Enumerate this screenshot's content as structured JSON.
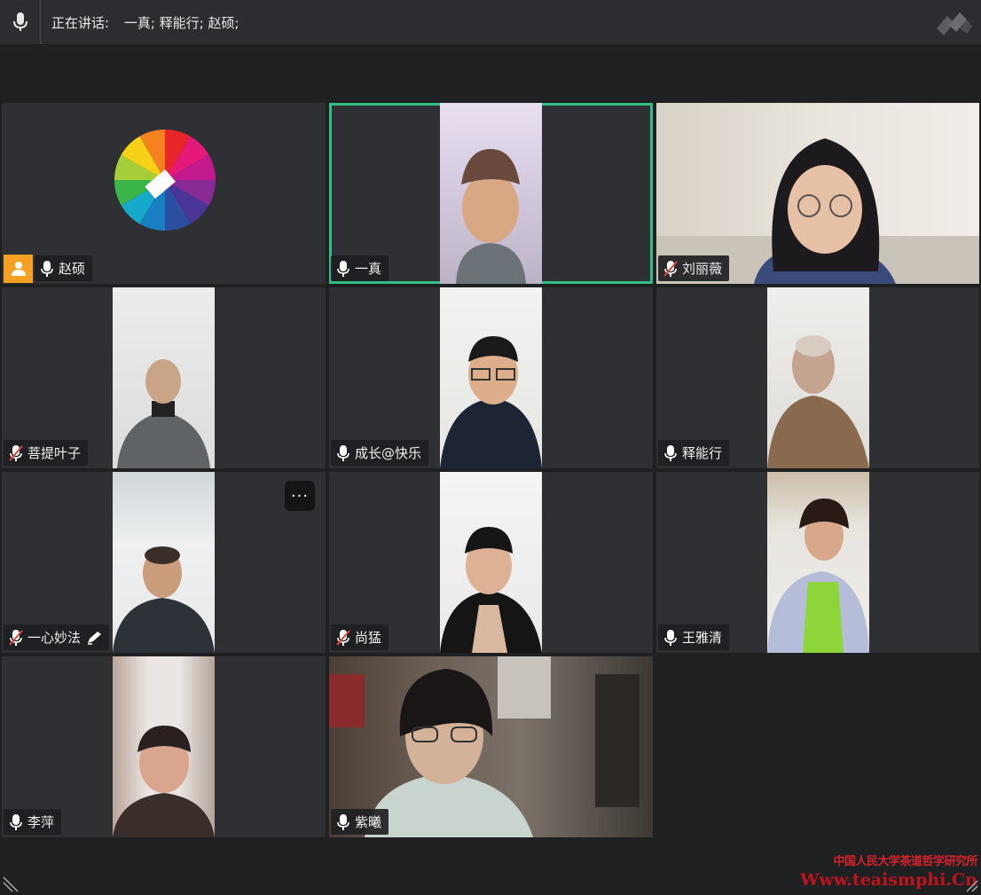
{
  "topbar": {
    "speaking_label": "正在讲话:",
    "speaking_names": "一真; 释能行; 赵硕;",
    "mic_icon": "microphone-icon",
    "logo_icon": "app-logo-icon"
  },
  "participants": [
    {
      "name": "赵硕",
      "mic": "on",
      "host": true,
      "video": "color-wheel-avatar"
    },
    {
      "name": "一真",
      "mic": "on",
      "active_speaker": true,
      "video": "camera"
    },
    {
      "name": "刘丽薇",
      "mic": "muted",
      "video": "camera-wide"
    },
    {
      "name": "菩提叶子",
      "mic": "muted",
      "video": "camera"
    },
    {
      "name": "成长@快乐",
      "mic": "on",
      "video": "camera"
    },
    {
      "name": "释能行",
      "mic": "on",
      "video": "camera"
    },
    {
      "name": "一心妙法",
      "mic": "muted",
      "annotate": true,
      "video": "camera"
    },
    {
      "name": "尚猛",
      "mic": "muted",
      "video": "camera"
    },
    {
      "name": "王雅清",
      "mic": "on",
      "video": "camera"
    },
    {
      "name": "李萍",
      "mic": "on",
      "video": "camera"
    },
    {
      "name": "紫曦",
      "mic": "on",
      "video": "camera-wide"
    }
  ],
  "more_button": "···",
  "watermark": {
    "line1": "中国人民大学茶道哲学研究所",
    "line2": "Www.teaismphi.Cn"
  },
  "colors": {
    "active_border": "#2fbf86",
    "host_badge": "#f5a020",
    "muted_slash": "#e0413a",
    "watermark": "#d4232b"
  }
}
